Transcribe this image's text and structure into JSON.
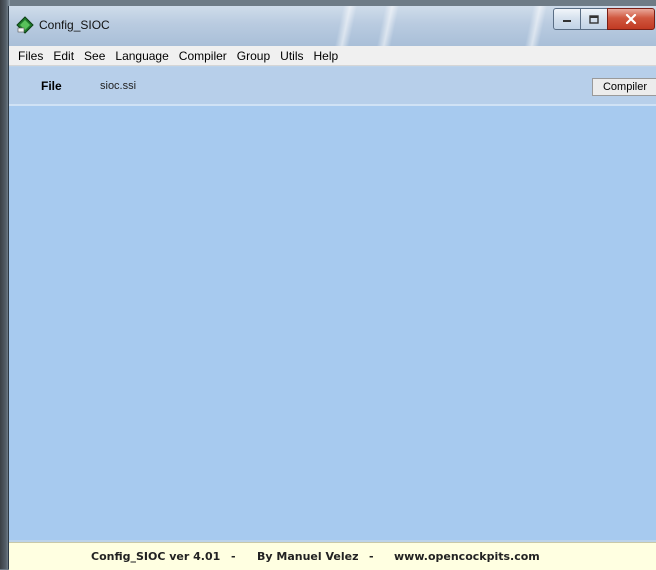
{
  "window": {
    "title": "Config_SIOC",
    "icon": "green-diamond-app-icon",
    "caption_buttons": [
      "minimize-icon",
      "maximize-icon",
      "close-icon"
    ]
  },
  "menubar": {
    "items": [
      "Files",
      "Edit",
      "See",
      "Language",
      "Compiler",
      "Group",
      "Utils",
      "Help"
    ]
  },
  "toolbar": {
    "file_label": "File",
    "file_value": "sioc.ssi",
    "compiler_button": "Compiler"
  },
  "statusbar": {
    "version": "Config_SIOC ver 4.01",
    "sep1": "-",
    "author": "By Manuel Velez",
    "sep2": "-",
    "website": "www.opencockpits.com"
  },
  "colors": {
    "main_background": "#a7caef",
    "toolbar_background": "#b7cfea",
    "statusbar_background": "#ffffe1",
    "close_button": "#c13a23"
  }
}
